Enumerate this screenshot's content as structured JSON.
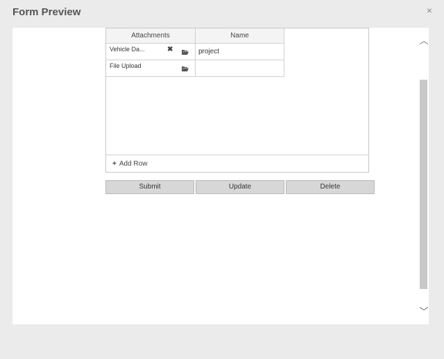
{
  "dialog": {
    "title": "Form Preview",
    "close_glyph": "×"
  },
  "grid": {
    "columns": [
      "Attachments",
      "Name"
    ],
    "rows": [
      {
        "attachment": "Vehicle Da...",
        "name": "project"
      },
      {
        "attachment": "File Upload",
        "name": ""
      }
    ],
    "add_row_label": "Add Row",
    "add_row_icon": "plus-icon",
    "remove_glyph": "✖"
  },
  "buttons": {
    "submit": "Submit",
    "update": "Update",
    "delete": "Delete"
  },
  "scroll": {
    "up_glyph": "︿",
    "down_glyph": "﹀"
  },
  "colors": {
    "background": "#ebebeb",
    "button": "#d7d7d7",
    "scroll_thumb": "#c8c8c8"
  }
}
